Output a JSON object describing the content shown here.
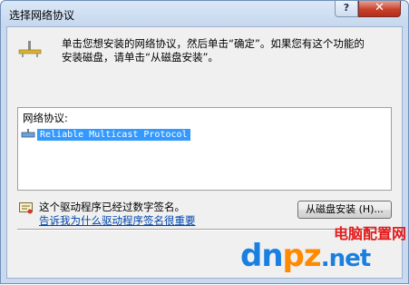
{
  "window": {
    "title": "选择网络协议",
    "help_label": "?",
    "close_label": "✕"
  },
  "instruction": {
    "line1": "单击您想安装的网络协议，然后单击“确定”。如果您有这个功能的",
    "line2": "安装磁盘，请单击“从磁盘安装”。"
  },
  "protocol_list": {
    "header": "网络协议:",
    "items": [
      {
        "label": "Reliable Multicast Protocol",
        "selected": true
      }
    ]
  },
  "driver": {
    "signed_text": "这个驱动程序已经过数字签名。",
    "why_link": "告诉我为什么驱动程序签名很重要",
    "have_disk_button": "从磁盘安装 (H)..."
  },
  "watermark": {
    "site": "电脑配置网",
    "logo_part1": "dn",
    "logo_part2": "pz",
    "logo_part3": ".net"
  },
  "colors": {
    "selection": "#3399ff",
    "link": "#0047ad",
    "close_button": "#c8402b"
  },
  "icons": [
    "network-connector-icon",
    "protocol-item-icon",
    "signed-driver-icon"
  ]
}
